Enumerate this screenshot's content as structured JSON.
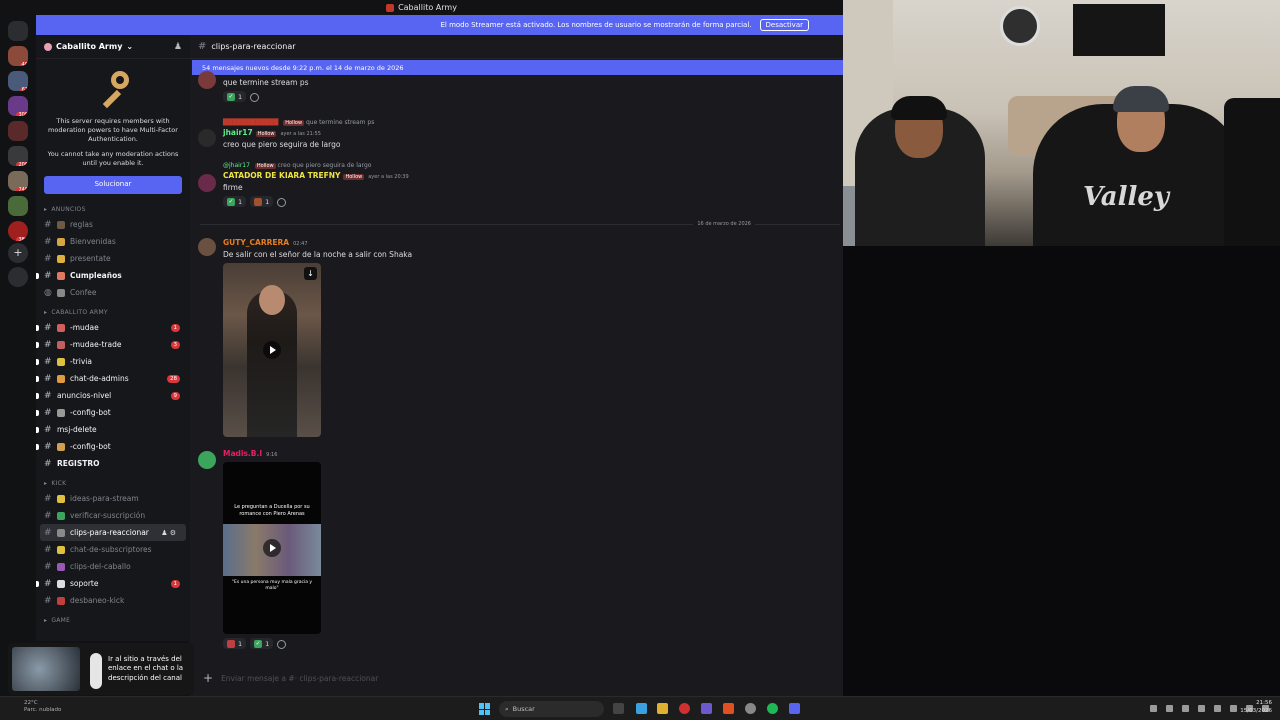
{
  "window": {
    "title": "Caballito Army"
  },
  "banner": {
    "text": "El modo Streamer está activado. Los nombres de usuario se mostrarán de forma parcial.",
    "button": "Desactivar"
  },
  "server": {
    "name": "Caballito Army",
    "mfa_text": "This server requires members with moderation powers to have Multi-Factor Authentication.",
    "mfa_sub": "You cannot take any moderation actions until you enable it.",
    "mfa_button": "Solucionar",
    "rail_badges": [
      "40",
      "61",
      "309",
      "206",
      "748",
      "386"
    ]
  },
  "categories": {
    "anuncios": "ANUNCIOS",
    "caballito": "CABALLITO ARMY",
    "kick": "KICK",
    "game": "GAME"
  },
  "channels_anuncios": [
    {
      "label": "reglas"
    },
    {
      "label": "Bienvenidas"
    },
    {
      "label": "presentate"
    },
    {
      "label": "Cumpleaños"
    },
    {
      "label": "Confee"
    }
  ],
  "channels_caballito": [
    {
      "label": "-mudae",
      "count": "1"
    },
    {
      "label": "-mudae-trade",
      "count": "3"
    },
    {
      "label": "-trivia",
      "count": ""
    },
    {
      "label": "chat-de-admins",
      "count": "28"
    },
    {
      "label": "anuncios-nivel",
      "count": "9"
    },
    {
      "label": "-config-bot",
      "count": ""
    },
    {
      "label": "msj-delete",
      "count": ""
    },
    {
      "label": "-config-bot",
      "count": ""
    },
    {
      "label": "REGISTRO",
      "count": ""
    }
  ],
  "channels_kick": [
    {
      "label": "ideas-para-stream",
      "count": ""
    },
    {
      "label": "verificar-suscripción",
      "count": ""
    },
    {
      "label": "clips-para-reaccionar",
      "count": ""
    },
    {
      "label": "chat-de-subscriptores",
      "count": ""
    },
    {
      "label": "clips-del-caballo",
      "count": ""
    },
    {
      "label": "soporte",
      "count": "1"
    },
    {
      "label": "desbaneo-kick",
      "count": ""
    }
  ],
  "channel": {
    "name": "clips-para-reaccionar",
    "new_messages": "54 mensajes nuevos desde 9:22 p.m. el 14 de marzo de 2026",
    "input_placeholder": "Enviar mensaje a #· clips-para-reaccionar"
  },
  "messages": {
    "m0": {
      "text": "que termine stream ps",
      "r1": "1"
    },
    "m1": {
      "reply_tag": "Hollow",
      "reply_text": "que termine stream ps",
      "author": "jhair17",
      "tag": "Hollow",
      "time": "ayer a las 21:55",
      "text": "creo que piero seguira de largo"
    },
    "m2": {
      "reply_author": "@jhair17",
      "reply_tag": "Hollow",
      "reply_text": "creo que piero seguira de largo",
      "author": "CATADOR DE KIARA TREFNY",
      "tag": "Hollow",
      "time": "ayer a las 20:39",
      "text": "firme",
      "r1": "1",
      "r2": "1"
    },
    "date_divider": "16 de marzo de 2026",
    "m3": {
      "author": "GUTY_CARRERA",
      "time": "02:47",
      "text": "De salir con el señor de la noche a salir con Shaka"
    },
    "m4": {
      "author": "Madis.B.I",
      "time": "9:16",
      "video_caption": "Le preguntan a Ducella por su romance con Piero Arenas",
      "video_caption2": "\"Es una persona muy mala gracia y malo\"",
      "r1": "1",
      "r2": "1"
    }
  },
  "toast": {
    "text": "Ir al sitio a través del enlace en el chat o la descripción del canal"
  },
  "weather": {
    "temp": "22°C",
    "desc": "Parc. nublado"
  },
  "taskbar": {
    "search": "Buscar",
    "time": "21:56",
    "date": "15/03/2026"
  },
  "colors": {
    "accent": "#5865f2",
    "green": "#3ba55d",
    "badge": "#da373c",
    "name_yellow": "#f0e442",
    "name_green": "#57f287",
    "name_orange": "#e67e22",
    "name_pink": "#e91e63"
  }
}
